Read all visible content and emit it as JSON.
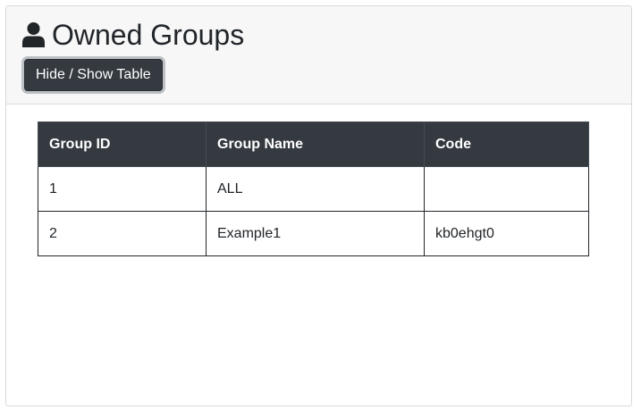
{
  "header": {
    "title": "Owned Groups",
    "icon": "user-icon",
    "toggle_button_label": "Hide / Show Table"
  },
  "table": {
    "columns": [
      "Group ID",
      "Group Name",
      "Code"
    ],
    "rows": [
      [
        "1",
        "ALL",
        ""
      ],
      [
        "2",
        "Example1",
        "kb0ehgt0"
      ]
    ]
  },
  "colors": {
    "header_bg": "#f7f7f7",
    "button_bg": "#343a40",
    "table_header_bg": "#343a40"
  }
}
